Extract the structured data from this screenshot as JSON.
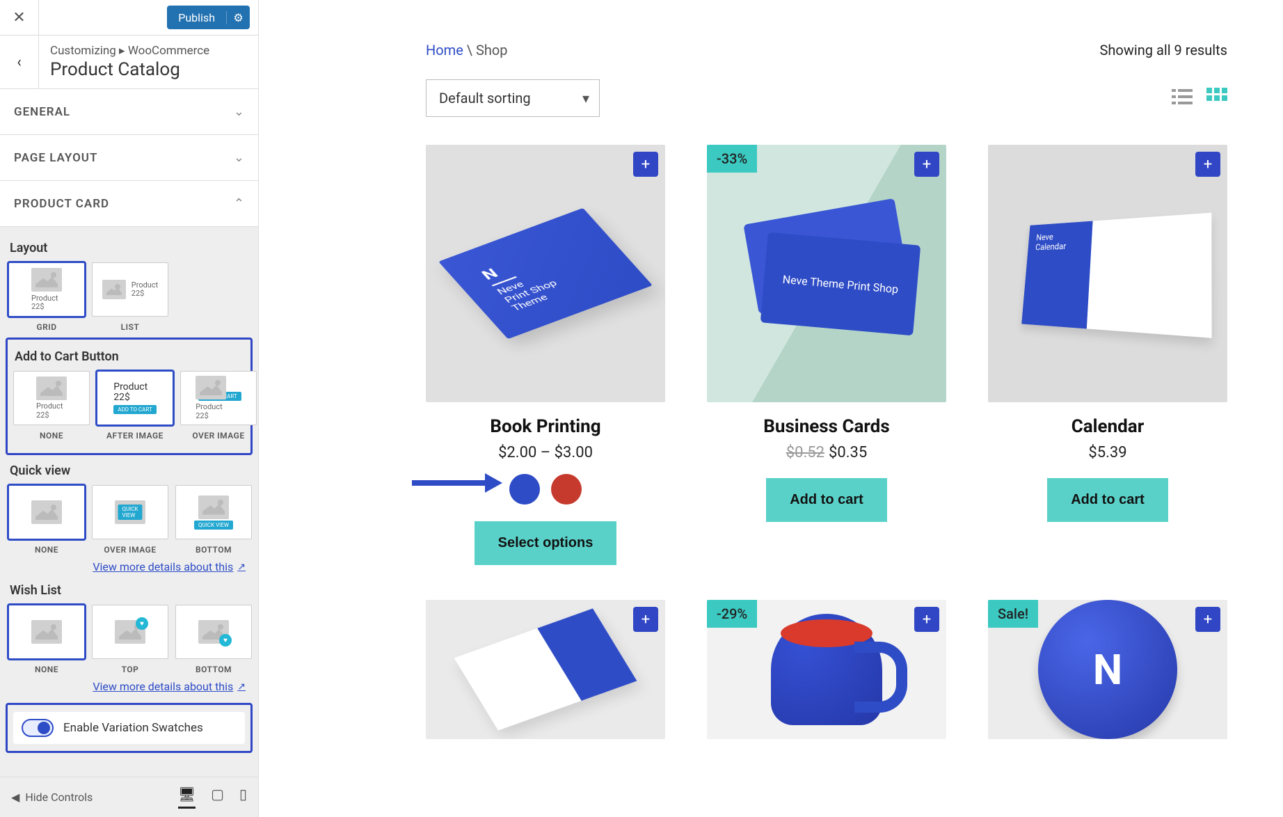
{
  "sidebar": {
    "publish": "Publish",
    "crumb_prefix": "Customizing ▸ ",
    "crumb_section": "WooCommerce",
    "title": "Product Catalog",
    "accordions": [
      {
        "label": "GENERAL",
        "expanded": false
      },
      {
        "label": "PAGE LAYOUT",
        "expanded": false
      },
      {
        "label": "PRODUCT CARD",
        "expanded": true
      }
    ],
    "layout": {
      "heading": "Layout",
      "options": [
        "GRID",
        "LIST"
      ],
      "selected": "GRID",
      "thumb_product": "Product",
      "thumb_price": "22$"
    },
    "atc": {
      "heading": "Add to Cart Button",
      "options": [
        "NONE",
        "AFTER IMAGE",
        "OVER IMAGE"
      ],
      "selected": "AFTER IMAGE",
      "thumb_product": "Product",
      "thumb_price": "22$",
      "thumb_btn": "ADD TO CART"
    },
    "quickview": {
      "heading": "Quick view",
      "options": [
        "NONE",
        "OVER IMAGE",
        "BOTTOM"
      ],
      "selected": "NONE",
      "thumb_btn": "QUICK VIEW",
      "more": "View more details about this"
    },
    "wishlist": {
      "heading": "Wish List",
      "options": [
        "NONE",
        "TOP",
        "BOTTOM"
      ],
      "selected": "NONE",
      "more": "View more details about this"
    },
    "variation": {
      "label": "Enable Variation Swatches",
      "on": true
    },
    "footer": {
      "hide": "Hide Controls"
    }
  },
  "preview": {
    "breadcrumb_home": "Home",
    "breadcrumb_sep": " \\ ",
    "breadcrumb_current": "Shop",
    "results": "Showing all 9 results",
    "sort": "Default sorting",
    "products": [
      {
        "name": "Book Printing",
        "price": "$2.00 – $3.00",
        "cta": "Select options",
        "swatches": [
          "#2e4cc6",
          "#c63a2e"
        ]
      },
      {
        "name": "Business Cards",
        "old_price": "$0.52",
        "price": "$0.35",
        "badge": "-33%",
        "cta": "Add to cart"
      },
      {
        "name": "Calendar",
        "price": "$5.39",
        "cta": "Add to cart"
      }
    ],
    "row2_badges": [
      "",
      "-29%",
      "Sale!"
    ]
  }
}
